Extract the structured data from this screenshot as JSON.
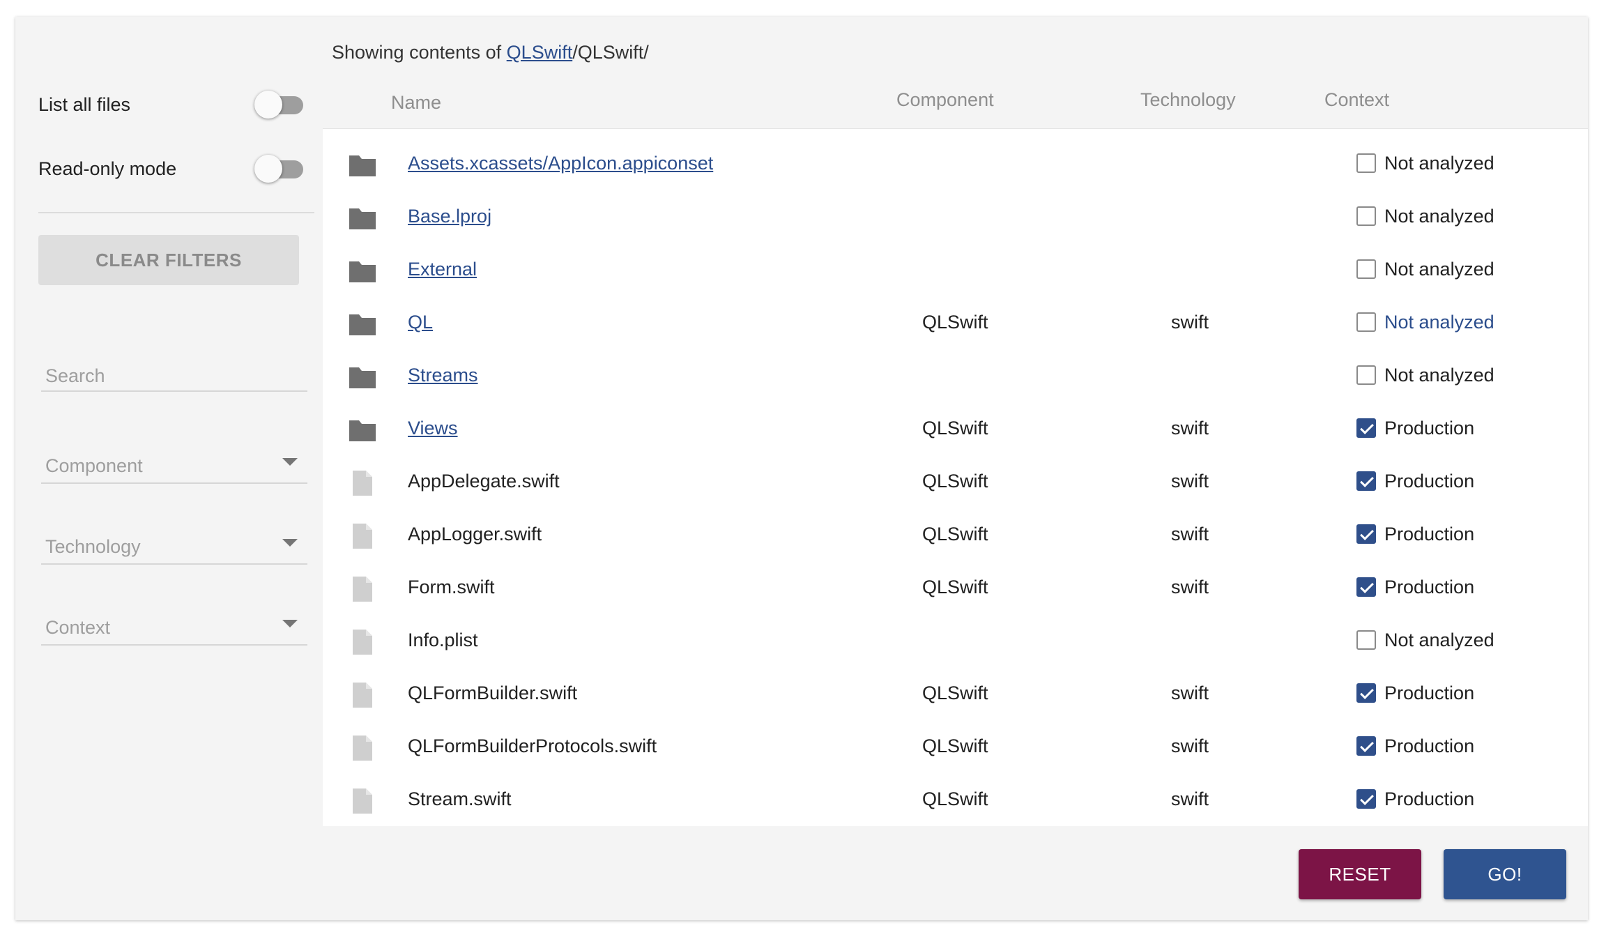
{
  "sidebar": {
    "list_all_files_label": "List all files",
    "read_only_mode_label": "Read-only mode",
    "clear_filters_label": "CLEAR FILTERS",
    "search_placeholder": "Search",
    "component_label": "Component",
    "technology_label": "Technology",
    "context_label": "Context"
  },
  "path": {
    "prefix": "Showing contents of ",
    "link": "QLSwift",
    "rest": "/QLSwift/"
  },
  "table": {
    "headers": {
      "name": "Name",
      "component": "Component",
      "technology": "Technology",
      "context": "Context"
    },
    "rows": [
      {
        "type": "folder",
        "name": "Assets.xcassets/AppIcon.appiconset",
        "component": "",
        "technology": "",
        "context": "Not analyzed",
        "checked": false
      },
      {
        "type": "folder",
        "name": "Base.lproj",
        "component": "",
        "technology": "",
        "context": "Not analyzed",
        "checked": false
      },
      {
        "type": "folder",
        "name": "External",
        "component": "",
        "technology": "",
        "context": "Not analyzed",
        "checked": false
      },
      {
        "type": "folder",
        "name": "QL",
        "component": "QLSwift",
        "technology": "swift",
        "context": "Not analyzed",
        "checked": false,
        "context_highlight": true
      },
      {
        "type": "folder",
        "name": "Streams",
        "component": "",
        "technology": "",
        "context": "Not analyzed",
        "checked": false
      },
      {
        "type": "folder",
        "name": "Views",
        "component": "QLSwift",
        "technology": "swift",
        "context": "Production",
        "checked": true
      },
      {
        "type": "file",
        "name": "AppDelegate.swift",
        "component": "QLSwift",
        "technology": "swift",
        "context": "Production",
        "checked": true
      },
      {
        "type": "file",
        "name": "AppLogger.swift",
        "component": "QLSwift",
        "technology": "swift",
        "context": "Production",
        "checked": true
      },
      {
        "type": "file",
        "name": "Form.swift",
        "component": "QLSwift",
        "technology": "swift",
        "context": "Production",
        "checked": true
      },
      {
        "type": "file",
        "name": "Info.plist",
        "component": "",
        "technology": "",
        "context": "Not analyzed",
        "checked": false
      },
      {
        "type": "file",
        "name": "QLFormBuilder.swift",
        "component": "QLSwift",
        "technology": "swift",
        "context": "Production",
        "checked": true
      },
      {
        "type": "file",
        "name": "QLFormBuilderProtocols.swift",
        "component": "QLSwift",
        "technology": "swift",
        "context": "Production",
        "checked": true
      },
      {
        "type": "file",
        "name": "Stream.swift",
        "component": "QLSwift",
        "technology": "swift",
        "context": "Production",
        "checked": true
      }
    ]
  },
  "buttons": {
    "reset_label": "RESET",
    "go_label": "GO!"
  },
  "colors": {
    "link": "#2b4d8c",
    "checkbox_checked": "#2f4f8a",
    "reset": "#7c1446",
    "go": "#2f5490"
  }
}
